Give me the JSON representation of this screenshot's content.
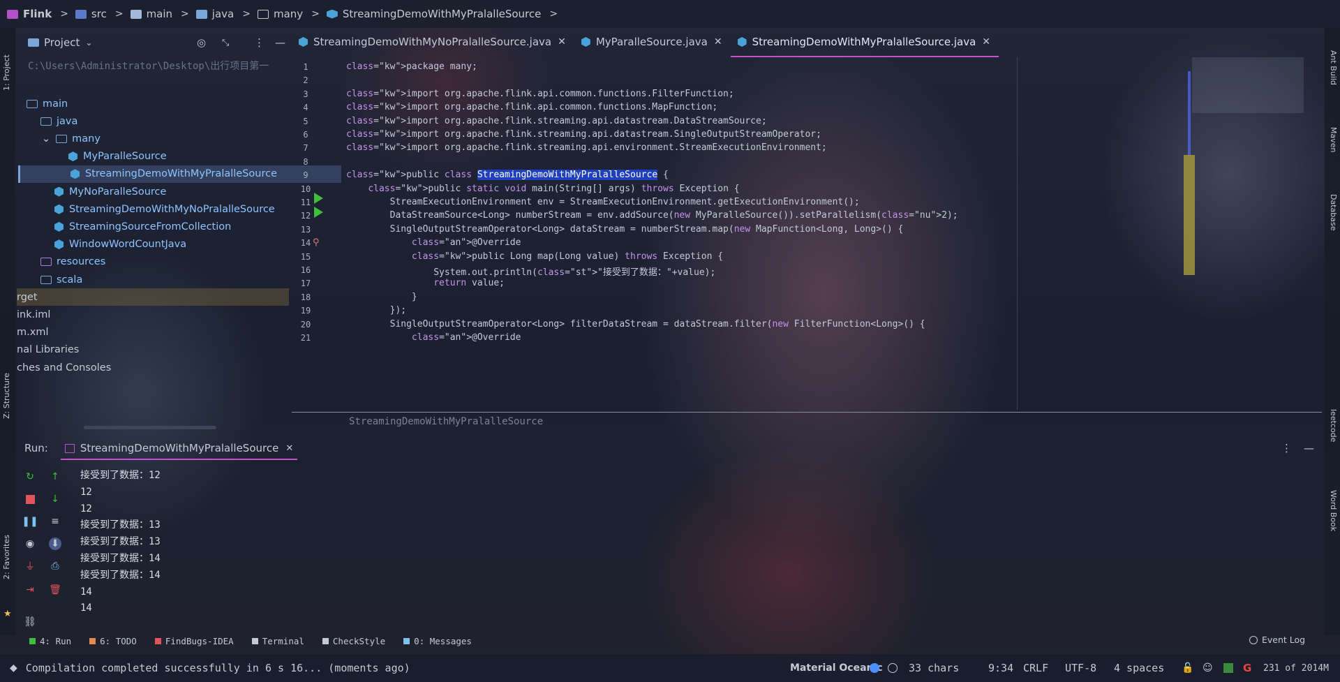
{
  "breadcrumb": [
    {
      "label": "Flink",
      "icon": "project-icon"
    },
    {
      "label": "src",
      "icon": "source-folder-icon"
    },
    {
      "label": "main",
      "icon": "folder-icon"
    },
    {
      "label": "java",
      "icon": "folder-icon"
    },
    {
      "label": "many",
      "icon": "package-icon"
    },
    {
      "label": "StreamingDemoWithMyPralalleSource",
      "icon": "java-class-icon"
    }
  ],
  "left_strip": {
    "project": "1: Project",
    "structure": "Z: Structure",
    "favorites": "2: Favorites"
  },
  "right_strip": {
    "ant": "Ant Build",
    "maven": "Maven",
    "database": "Database",
    "leetcode": "leetcode",
    "wordbook": "Word Book"
  },
  "project": {
    "title": "Project",
    "path": "C:\\Users\\Administrator\\Desktop\\出行项目第一",
    "tree": [
      {
        "label": "main",
        "indent": 0,
        "type": "folder"
      },
      {
        "label": "java",
        "indent": 1,
        "type": "folder"
      },
      {
        "label": "many",
        "indent": 2,
        "type": "package"
      },
      {
        "label": "MyParalleSource",
        "indent": 3,
        "type": "class"
      },
      {
        "label": "StreamingDemoWithMyPralalleSource",
        "indent": 3,
        "type": "class",
        "selected": true
      },
      {
        "label": "MyNoParalleSource",
        "indent": 2,
        "type": "class"
      },
      {
        "label": "StreamingDemoWithMyNoPralalleSource",
        "indent": 2,
        "type": "class"
      },
      {
        "label": "StreamingSourceFromCollection",
        "indent": 2,
        "type": "class"
      },
      {
        "label": "WindowWordCountJava",
        "indent": 2,
        "type": "class"
      },
      {
        "label": "resources",
        "indent": 1,
        "type": "folder"
      },
      {
        "label": "scala",
        "indent": 1,
        "type": "folder"
      },
      {
        "label": "rget",
        "indent": -1,
        "type": "text"
      },
      {
        "label": "ink.iml",
        "indent": -1,
        "type": "text"
      },
      {
        "label": "m.xml",
        "indent": -1,
        "type": "text"
      },
      {
        "label": "nal Libraries",
        "indent": -1,
        "type": "text"
      },
      {
        "label": "ches and Consoles",
        "indent": -1,
        "type": "text"
      }
    ]
  },
  "tabs": [
    {
      "label": "StreamingDemoWithMyNoPralalleSource.java",
      "active": false
    },
    {
      "label": "MyParalleSource.java",
      "active": false
    },
    {
      "label": "StreamingDemoWithMyPralalleSource.java",
      "active": true
    }
  ],
  "editor": {
    "lines": [
      "package many;",
      "",
      "import org.apache.flink.api.common.functions.FilterFunction;",
      "import org.apache.flink.api.common.functions.MapFunction;",
      "import org.apache.flink.streaming.api.datastream.DataStreamSource;",
      "import org.apache.flink.streaming.api.datastream.SingleOutputStreamOperator;",
      "import org.apache.flink.streaming.api.environment.StreamExecutionEnvironment;",
      "",
      "public class StreamingDemoWithMyPralalleSource {",
      "    public static void main(String[] args) throws Exception {",
      "        StreamExecutionEnvironment env = StreamExecutionEnvironment.getExecutionEnvironment();",
      "        DataStreamSource<Long> numberStream = env.addSource(new MyParalleSource()).setParallelism(2);",
      "        SingleOutputStreamOperator<Long> dataStream = numberStream.map(new MapFunction<Long, Long>() {",
      "            @Override",
      "            public Long map(Long value) throws Exception {",
      "                System.out.println(\"接受到了数据：\"+value);",
      "                return value;",
      "            }",
      "        });",
      "        SingleOutputStreamOperator<Long> filterDataStream = dataStream.filter(new FilterFunction<Long>() {",
      "            @Override"
    ],
    "footer": "StreamingDemoWithMyPralalleSource"
  },
  "run": {
    "label": "Run:",
    "config": "StreamingDemoWithMyPralalleSource",
    "output": [
      "接受到了数据：12",
      "12",
      "12",
      "接受到了数据：13",
      "接受到了数据：13",
      "接受到了数据：14",
      "接受到了数据：14",
      "14",
      "14"
    ]
  },
  "tool_windows": [
    {
      "label": "4: Run",
      "icon": "run-icon"
    },
    {
      "label": "6: TODO",
      "icon": "todo-icon"
    },
    {
      "label": "FindBugs-IDEA",
      "icon": "bug-icon"
    },
    {
      "label": "Terminal",
      "icon": "terminal-icon"
    },
    {
      "label": "CheckStyle",
      "icon": "checkstyle-icon"
    },
    {
      "label": "0: Messages",
      "icon": "messages-icon"
    }
  ],
  "event_log": "Event Log",
  "status": {
    "message": "Compilation completed successfully in 6 s 16... (moments ago)",
    "theme": "Material Oceanic",
    "chars": "33 chars",
    "position": "9:34",
    "line_sep": "CRLF",
    "encoding": "UTF-8",
    "indent": "4 spaces",
    "memory": "231 of 2014M"
  },
  "colors": {
    "accent": "#c44fd0",
    "selection": "#1f3fbf",
    "run_green": "#3ebd3e"
  }
}
